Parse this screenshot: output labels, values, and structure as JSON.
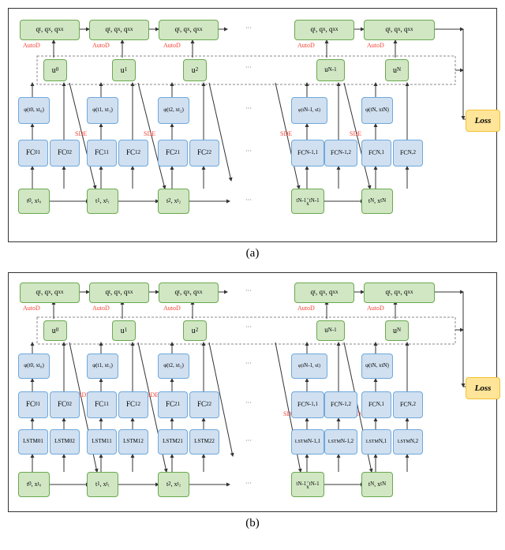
{
  "caption_a": "(a)",
  "caption_b": "(b)",
  "loss": "Loss",
  "autod": "AutoD",
  "sde": "SDE",
  "ellipsis": "···",
  "q_out": "q, q  , q",
  "q_sub": [
    "t",
    "x",
    "xx"
  ],
  "u": [
    "u",
    "u",
    "u",
    "u",
    "u"
  ],
  "u_sub": [
    "0",
    "1",
    "2",
    "N-1",
    "N"
  ],
  "phi": [
    "φ(t , x  )",
    "φ(t , x  )",
    "φ(t , x  )",
    "φ(t    , x    )",
    "φ(t , x  )"
  ],
  "phi_sub": [
    [
      "0",
      "t₀"
    ],
    [
      "1",
      "t₁"
    ],
    [
      "2",
      "t₂"
    ],
    [
      "N-1",
      "tN-1"
    ],
    [
      "N",
      "tN"
    ]
  ],
  "fc": [
    [
      "FC",
      "FC"
    ],
    [
      "FC",
      "FC"
    ],
    [
      "FC",
      "FC"
    ],
    [
      "FC",
      "FC"
    ],
    [
      "FC",
      "FC"
    ]
  ],
  "fc_sub": [
    [
      "01",
      "02"
    ],
    [
      "11",
      "12"
    ],
    [
      "21",
      "22"
    ],
    [
      "N-1,1",
      "N-1,2"
    ],
    [
      "N,1",
      "N,2"
    ]
  ],
  "lstm": [
    [
      "LSTM",
      "LSTM"
    ],
    [
      "LSTM",
      "LSTM"
    ],
    [
      "LSTM",
      "LSTM"
    ],
    [
      "LSTM",
      "LSTM"
    ],
    [
      "LSTM",
      "LSTM"
    ]
  ],
  "lstm_sub": [
    [
      "01",
      "02"
    ],
    [
      "11",
      "12"
    ],
    [
      "21",
      "22"
    ],
    [
      "N-1,1",
      "N-1,2"
    ],
    [
      "N,1",
      "N,2"
    ]
  ],
  "tx": [
    "t , x",
    "t , x",
    "t , x",
    "t    ,\nx",
    "t , x"
  ],
  "tx_sub": [
    [
      "0",
      "t₀"
    ],
    [
      "1",
      "t₁"
    ],
    [
      "2",
      "t₂"
    ],
    [
      "N-1",
      "tN-1"
    ],
    [
      "N",
      "tN"
    ]
  ]
}
